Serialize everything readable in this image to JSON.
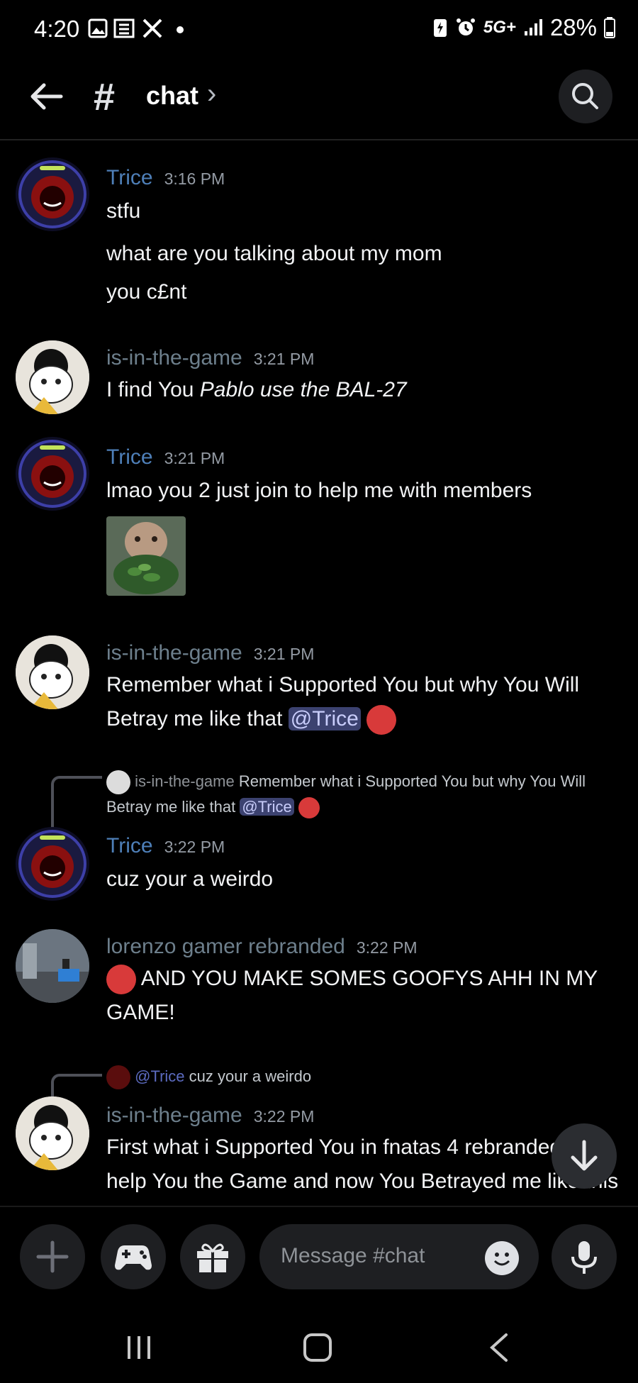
{
  "status_bar": {
    "time": "4:20",
    "network": "5G+",
    "battery": "28%"
  },
  "header": {
    "hash": "#",
    "channel": "chat",
    "chevron": "›"
  },
  "messages": [
    {
      "author": "Trice",
      "time": "3:16 PM",
      "lines": [
        "stfu",
        "what are you talking about my mom",
        "you c£nt"
      ]
    },
    {
      "author": "is-in-the-game",
      "time": "3:21 PM",
      "text_plain": "I find You ",
      "text_italic": "Pablo use the BAL-27"
    },
    {
      "author": "Trice",
      "time": "3:21 PM",
      "text": "lmao you 2 just join to help me with members"
    },
    {
      "author": "is-in-the-game",
      "time": "3:21 PM",
      "text": "Remember what i Supported You but why You Will Betray me like that",
      "mention": "@Trice"
    },
    {
      "author": "Trice",
      "time": "3:22 PM",
      "text": "cuz your a weirdo",
      "reply": {
        "author": "is-in-the-game",
        "text": "Remember what i Supported You but why You Will Betray me like that",
        "mention": "@Trice"
      }
    },
    {
      "author": "lorenzo gamer rebranded",
      "time": "3:22 PM",
      "text": "AND YOU MAKE SOMES GOOFYS AHH IN MY GAME!"
    },
    {
      "author": "is-in-the-game",
      "time": "3:22 PM",
      "text": "First what i Supported You in fnatas 4 rebranded then help You the Game and now You Betrayed me like this",
      "reply": {
        "author": "@Trice",
        "text": "cuz your a weirdo"
      }
    }
  ],
  "composer": {
    "placeholder": "Message #chat"
  },
  "colors": {
    "background": "#000000",
    "trice_name": "#4e7fb8",
    "member_name": "#6d7f8c",
    "mention_bg": "#3c4270"
  }
}
